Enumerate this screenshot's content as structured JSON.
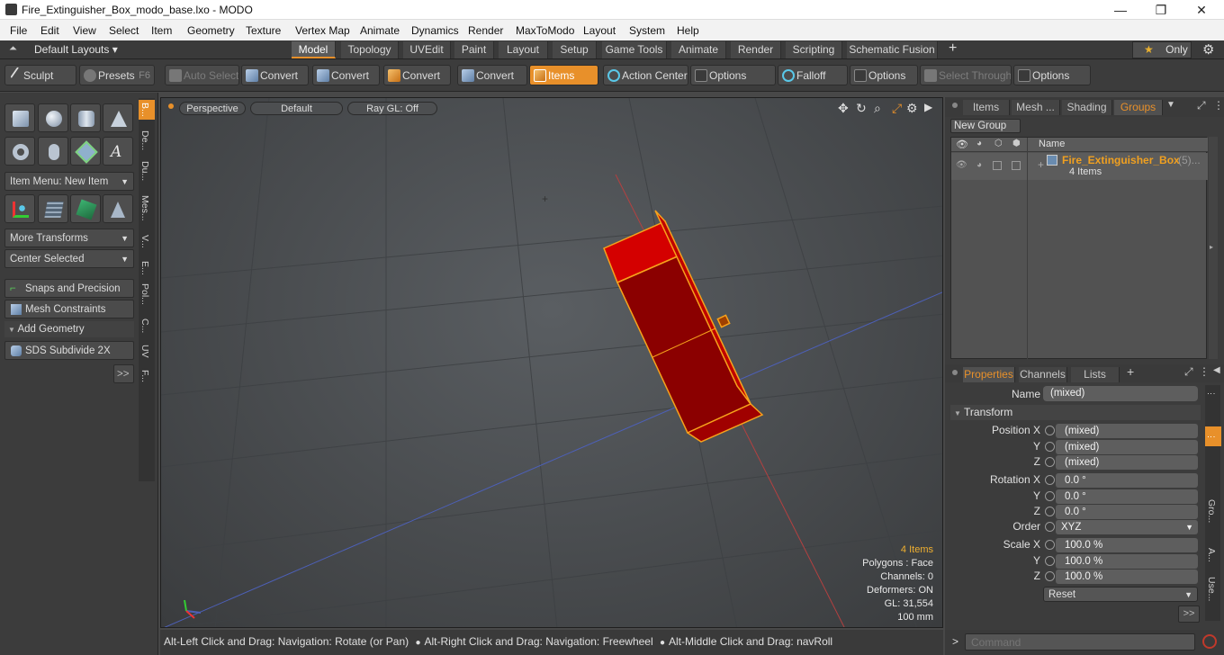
{
  "window": {
    "title": "Fire_Extinguisher_Box_modo_base.lxo - MODO",
    "minimize": "—",
    "maximize": "❐",
    "close": "✕"
  },
  "menu": [
    "File",
    "Edit",
    "View",
    "Select",
    "Item",
    "Geometry",
    "Texture",
    "Vertex Map",
    "Animate",
    "Dynamics",
    "Render",
    "MaxToModo",
    "Layout",
    "System",
    "Help"
  ],
  "layouts": {
    "dropdown": "Default Layouts",
    "tabs": [
      "Model",
      "Topology",
      "UVEdit",
      "Paint",
      "Layout",
      "Setup",
      "Game Tools",
      "Animate",
      "Render",
      "Scripting",
      "Schematic Fusion"
    ],
    "selected": "Model",
    "add": "+",
    "only": "Only"
  },
  "toolbar": {
    "sculpt": "Sculpt",
    "presets": "Presets",
    "presets_key": "F6",
    "auto_select": "Auto Select",
    "convert1": "Convert",
    "convert2": "Convert",
    "convert3": "Convert",
    "convert4": "Convert",
    "items": "Items",
    "action_center": "Action Center",
    "options1": "Options",
    "falloff": "Falloff",
    "options2": "Options",
    "select_through": "Select Through",
    "options3": "Options"
  },
  "left": {
    "item_menu": "Item Menu: New Item",
    "more_transforms": "More Transforms",
    "center_selected": "Center Selected",
    "snaps": "Snaps and Precision",
    "mesh_constraints": "Mesh Constraints",
    "add_geometry": "Add Geometry",
    "sds": "SDS Subdivide 2X",
    "more": ">>",
    "vtabs": [
      "B...",
      "De...",
      "Du...",
      "Mes...",
      "V...",
      "E...",
      "Pol...",
      "C...",
      "UV",
      "F..."
    ]
  },
  "viewport": {
    "view": "Perspective",
    "shading": "Default",
    "raygl": "Ray GL: Off",
    "hud": {
      "items": "4 Items",
      "polygons": "Polygons : Face",
      "channels": "Channels: 0",
      "deformers": "Deformers: ON",
      "gl": "GL: 31,554",
      "unit": "100 mm"
    }
  },
  "status": {
    "hint1": "Alt-Left Click and Drag: Navigation: Rotate (or Pan)",
    "hint2": "Alt-Right Click and Drag: Navigation: Freewheel",
    "hint3": "Alt-Middle Click and Drag: navRoll"
  },
  "groups": {
    "tabs": [
      "Items",
      "Mesh ...",
      "Shading",
      "Groups"
    ],
    "selected": "Groups",
    "new_group": "New Group",
    "col_name": "Name",
    "row_name": "Fire_Extinguisher_Box",
    "row_count": "(5)...",
    "row_sub": "4 Items"
  },
  "properties": {
    "tabs": [
      "Properties",
      "Channels",
      "Lists"
    ],
    "name_label": "Name",
    "name_value": "(mixed)",
    "transform": "Transform",
    "pos_x_label": "Position X",
    "pos_x": "(mixed)",
    "pos_y_label": "Y",
    "pos_y": "(mixed)",
    "pos_z_label": "Z",
    "pos_z": "(mixed)",
    "rot_x_label": "Rotation X",
    "rot_x": "0.0 °",
    "rot_y_label": "Y",
    "rot_y": "0.0 °",
    "rot_z_label": "Z",
    "rot_z": "0.0 °",
    "order_label": "Order",
    "order": "XYZ",
    "scl_x_label": "Scale X",
    "scl_x": "100.0 %",
    "scl_y_label": "Y",
    "scl_y": "100.0 %",
    "scl_z_label": "Z",
    "scl_z": "100.0 %",
    "reset": "Reset",
    "more": ">>",
    "side_tabs": [
      "Gro...",
      "A...",
      "Use..."
    ]
  },
  "command": {
    "placeholder": "Command",
    "prompt": ">"
  },
  "colors": {
    "accent": "#e8902a",
    "object_red": "#c40000",
    "wire_orange": "#f7a21b"
  }
}
